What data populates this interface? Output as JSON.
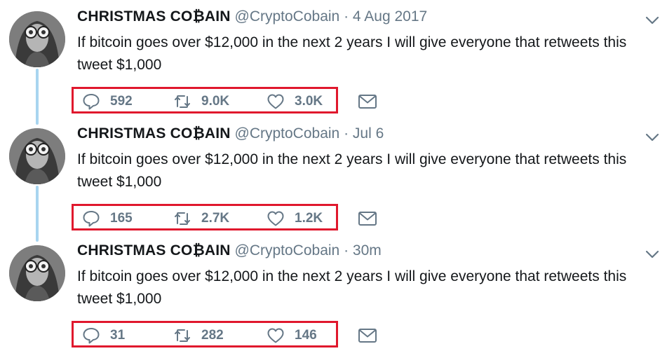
{
  "tweets": [
    {
      "name": "CHRISTMAS CO₿AIN",
      "handle": "@CryptoCobain",
      "separator": "·",
      "time": "4 Aug 2017",
      "text": "If bitcoin goes over $12,000 in the next 2 years I will give everyone that retweets this tweet $1,000",
      "replies": "592",
      "retweets": "9.0K",
      "likes": "3.0K"
    },
    {
      "name": "CHRISTMAS CO₿AIN",
      "handle": "@CryptoCobain",
      "separator": "·",
      "time": "Jul 6",
      "text": "If bitcoin goes over $12,000 in the next 2 years I will give everyone that retweets this tweet $1,000",
      "replies": "165",
      "retweets": "2.7K",
      "likes": "1.2K"
    },
    {
      "name": "CHRISTMAS CO₿AIN",
      "handle": "@CryptoCobain",
      "separator": "·",
      "time": "30m",
      "text": "If bitcoin goes over $12,000 in the next 2 years I will give everyone that retweets this tweet $1,000",
      "replies": "31",
      "retweets": "282",
      "likes": "146"
    }
  ],
  "icons": {
    "reply": "reply-icon",
    "retweet": "retweet-icon",
    "like": "heart-icon",
    "message": "envelope-icon",
    "menu": "chevron-down-icon"
  },
  "colors": {
    "text": "#14171a",
    "secondary": "#657786",
    "highlight_box": "#e0182d",
    "thread_line": "#a8d5f0"
  }
}
